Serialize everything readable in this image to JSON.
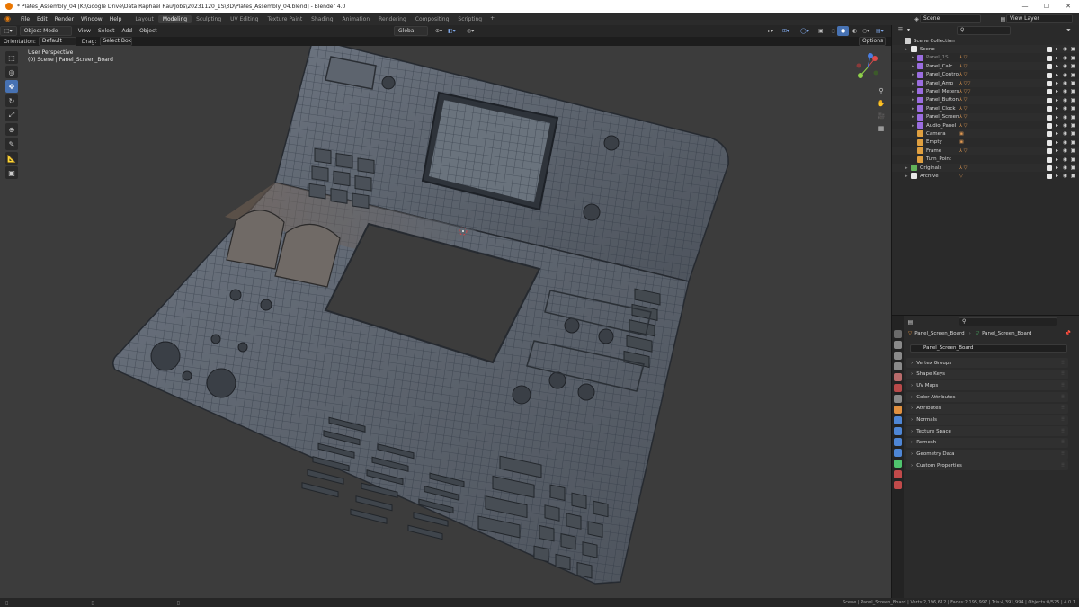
{
  "window": {
    "title": "* Plates_Assembly_04 [K:\\Google Drive\\Data Raphael Rau\\Jobs\\20231120_1S\\3D\\Plates_Assembly_04.blend] - Blender 4.0",
    "minimize_glyph": "—",
    "maximize_glyph": "☐",
    "close_glyph": "✕"
  },
  "menubar": {
    "logo_glyph": "◉",
    "items": [
      "File",
      "Edit",
      "Render",
      "Window",
      "Help"
    ],
    "workspaces": [
      "Layout",
      "Modeling",
      "Sculpting",
      "UV Editing",
      "Texture Paint",
      "Shading",
      "Animation",
      "Rendering",
      "Compositing",
      "Scripting"
    ],
    "active_workspace": "Modeling",
    "add_tab": "+",
    "scene": "Scene",
    "view_layer": "View Layer"
  },
  "viewport_header": {
    "mode": "Object Mode",
    "menus": [
      "View",
      "Select",
      "Add",
      "Object"
    ],
    "orientation_label": "Orientation:",
    "orientation_value": "Default",
    "drag_label": "Drag:",
    "drag_value": "Select Box",
    "transform_orientation": "Global",
    "options": "Options"
  },
  "viewport": {
    "view_name": "User Perspective",
    "context": "(0) Scene | Panel_Screen_Board",
    "background": "#3c3c3c"
  },
  "toolbar": {
    "tools": [
      "select-box",
      "cursor",
      "move",
      "rotate",
      "scale",
      "transform",
      "annotate",
      "measure",
      "add-cube"
    ],
    "active": "move"
  },
  "outliner": {
    "search_placeholder": "",
    "rows": [
      {
        "label": "Scene Collection",
        "type": "scene-collection",
        "indent": 0
      },
      {
        "label": "Scene",
        "type": "collection",
        "indent": 1,
        "mods": ""
      },
      {
        "label": "Panel_1S",
        "type": "collection-purple",
        "indent": 2,
        "mods": "⅄ ▽",
        "dim": true
      },
      {
        "label": "Panel_Calc",
        "type": "collection-purple",
        "indent": 2,
        "mods": "⅄ ▽"
      },
      {
        "label": "Panel_Control",
        "type": "collection-purple",
        "indent": 2,
        "mods": "⅄ ▽"
      },
      {
        "label": "Panel_Amp",
        "type": "collection-purple",
        "indent": 2,
        "mods": "⅄ ▽▽"
      },
      {
        "label": "Panel_Meters",
        "type": "collection-purple",
        "indent": 2,
        "mods": "⅄ ▽▽"
      },
      {
        "label": "Panel_Button",
        "type": "collection-purple",
        "indent": 2,
        "mods": "⅄ ▽"
      },
      {
        "label": "Panel_Clock",
        "type": "collection-purple",
        "indent": 2,
        "mods": "⅄ ▽"
      },
      {
        "label": "Panel_Screen",
        "type": "collection-purple",
        "indent": 2,
        "mods": "⅄ ▽"
      },
      {
        "label": "Audio_Panel",
        "type": "collection-purple",
        "indent": 2,
        "mods": "⅄ ▽"
      },
      {
        "label": "Camera",
        "type": "camera",
        "indent": 2,
        "mods": "▣"
      },
      {
        "label": "Empty",
        "type": "empty",
        "indent": 2,
        "mods": "▣"
      },
      {
        "label": "Frame",
        "type": "mesh",
        "indent": 2,
        "mods": "⅄ ▽"
      },
      {
        "label": "Turn_Point",
        "type": "empty",
        "indent": 2,
        "mods": ""
      },
      {
        "label": "Originals",
        "type": "collection-green",
        "indent": 1,
        "mods": "⅄ ▽"
      },
      {
        "label": "Archive",
        "type": "collection",
        "indent": 1,
        "mods": "▽"
      }
    ]
  },
  "properties": {
    "crumb_object": "Panel_Screen_Board",
    "crumb_data": "Panel_Screen_Board",
    "mesh_name": "Panel_Screen_Board",
    "panels": [
      "Vertex Groups",
      "Shape Keys",
      "UV Maps",
      "Color Attributes",
      "Attributes",
      "Normals",
      "Texture Space",
      "Remesh",
      "Geometry Data",
      "Custom Properties"
    ]
  },
  "statusbar": {
    "stats": "Scene | Panel_Screen_Board | Verts:2,196,612 | Faces:2,195,997 | Tris:4,391,994 | Objects:0/525 | 4.0.1"
  },
  "colors": {
    "accent": "#4772b3",
    "blender_orange": "#e87d0d",
    "collection_purple": "#9b6de0",
    "panel_metal": "#5f6670"
  }
}
